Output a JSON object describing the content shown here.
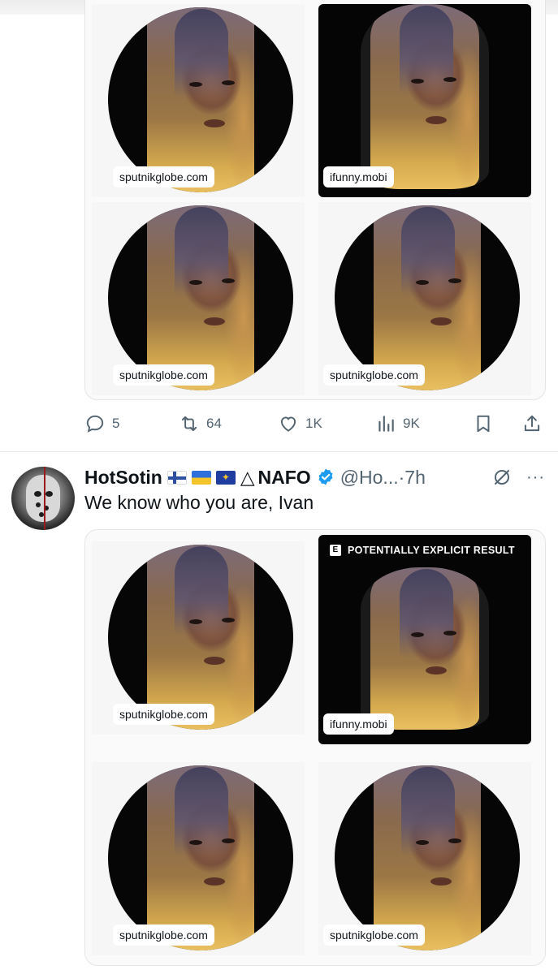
{
  "first_post": {
    "media": [
      {
        "source": "sputnikglobe.com",
        "style": "circle"
      },
      {
        "source": "ifunny.mobi",
        "style": "dark"
      },
      {
        "source": "sputnikglobe.com",
        "style": "circle"
      },
      {
        "source": "sputnikglobe.com",
        "style": "circle"
      }
    ],
    "actions": {
      "replies": "5",
      "reposts": "64",
      "likes": "1K",
      "views": "9K"
    }
  },
  "second_post": {
    "author": {
      "display_name": "HotSotin",
      "flags": [
        "flag-finland",
        "flag-ukraine",
        "flag-eu"
      ],
      "triangle": "△",
      "org": "NAFO",
      "verified": true,
      "handle": "@Ho...",
      "separator": "·",
      "time": "7h"
    },
    "text": "We know who you are, Ivan",
    "media": [
      {
        "source": "sputnikglobe.com",
        "style": "circle"
      },
      {
        "source": "ifunny.mobi",
        "style": "dark",
        "banner_badge": "E",
        "banner": "POTENTIALLY EXPLICIT RESULT"
      },
      {
        "source": "sputnikglobe.com",
        "style": "circle"
      },
      {
        "source": "sputnikglobe.com",
        "style": "circle"
      }
    ]
  },
  "colors": {
    "secondary_text": "#536471",
    "verified_blue": "#1d9bf0",
    "border": "#e3e6e9"
  }
}
